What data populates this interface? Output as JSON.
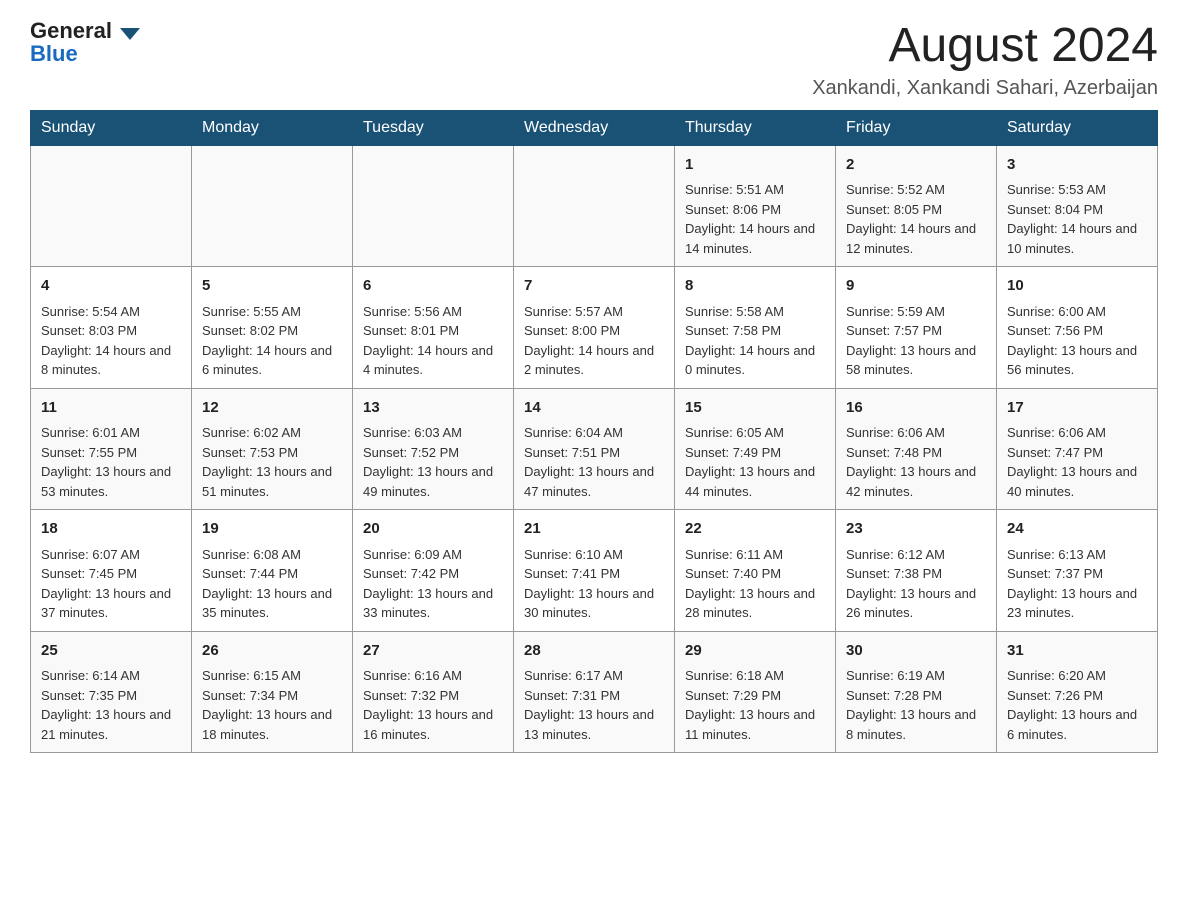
{
  "header": {
    "logo_general": "General",
    "logo_blue": "Blue",
    "month_year": "August 2024",
    "location": "Xankandi, Xankandi Sahari, Azerbaijan"
  },
  "weekdays": [
    "Sunday",
    "Monday",
    "Tuesday",
    "Wednesday",
    "Thursday",
    "Friday",
    "Saturday"
  ],
  "weeks": [
    [
      {
        "day": "",
        "sunrise": "",
        "sunset": "",
        "daylight": ""
      },
      {
        "day": "",
        "sunrise": "",
        "sunset": "",
        "daylight": ""
      },
      {
        "day": "",
        "sunrise": "",
        "sunset": "",
        "daylight": ""
      },
      {
        "day": "",
        "sunrise": "",
        "sunset": "",
        "daylight": ""
      },
      {
        "day": "1",
        "sunrise": "Sunrise: 5:51 AM",
        "sunset": "Sunset: 8:06 PM",
        "daylight": "Daylight: 14 hours and 14 minutes."
      },
      {
        "day": "2",
        "sunrise": "Sunrise: 5:52 AM",
        "sunset": "Sunset: 8:05 PM",
        "daylight": "Daylight: 14 hours and 12 minutes."
      },
      {
        "day": "3",
        "sunrise": "Sunrise: 5:53 AM",
        "sunset": "Sunset: 8:04 PM",
        "daylight": "Daylight: 14 hours and 10 minutes."
      }
    ],
    [
      {
        "day": "4",
        "sunrise": "Sunrise: 5:54 AM",
        "sunset": "Sunset: 8:03 PM",
        "daylight": "Daylight: 14 hours and 8 minutes."
      },
      {
        "day": "5",
        "sunrise": "Sunrise: 5:55 AM",
        "sunset": "Sunset: 8:02 PM",
        "daylight": "Daylight: 14 hours and 6 minutes."
      },
      {
        "day": "6",
        "sunrise": "Sunrise: 5:56 AM",
        "sunset": "Sunset: 8:01 PM",
        "daylight": "Daylight: 14 hours and 4 minutes."
      },
      {
        "day": "7",
        "sunrise": "Sunrise: 5:57 AM",
        "sunset": "Sunset: 8:00 PM",
        "daylight": "Daylight: 14 hours and 2 minutes."
      },
      {
        "day": "8",
        "sunrise": "Sunrise: 5:58 AM",
        "sunset": "Sunset: 7:58 PM",
        "daylight": "Daylight: 14 hours and 0 minutes."
      },
      {
        "day": "9",
        "sunrise": "Sunrise: 5:59 AM",
        "sunset": "Sunset: 7:57 PM",
        "daylight": "Daylight: 13 hours and 58 minutes."
      },
      {
        "day": "10",
        "sunrise": "Sunrise: 6:00 AM",
        "sunset": "Sunset: 7:56 PM",
        "daylight": "Daylight: 13 hours and 56 minutes."
      }
    ],
    [
      {
        "day": "11",
        "sunrise": "Sunrise: 6:01 AM",
        "sunset": "Sunset: 7:55 PM",
        "daylight": "Daylight: 13 hours and 53 minutes."
      },
      {
        "day": "12",
        "sunrise": "Sunrise: 6:02 AM",
        "sunset": "Sunset: 7:53 PM",
        "daylight": "Daylight: 13 hours and 51 minutes."
      },
      {
        "day": "13",
        "sunrise": "Sunrise: 6:03 AM",
        "sunset": "Sunset: 7:52 PM",
        "daylight": "Daylight: 13 hours and 49 minutes."
      },
      {
        "day": "14",
        "sunrise": "Sunrise: 6:04 AM",
        "sunset": "Sunset: 7:51 PM",
        "daylight": "Daylight: 13 hours and 47 minutes."
      },
      {
        "day": "15",
        "sunrise": "Sunrise: 6:05 AM",
        "sunset": "Sunset: 7:49 PM",
        "daylight": "Daylight: 13 hours and 44 minutes."
      },
      {
        "day": "16",
        "sunrise": "Sunrise: 6:06 AM",
        "sunset": "Sunset: 7:48 PM",
        "daylight": "Daylight: 13 hours and 42 minutes."
      },
      {
        "day": "17",
        "sunrise": "Sunrise: 6:06 AM",
        "sunset": "Sunset: 7:47 PM",
        "daylight": "Daylight: 13 hours and 40 minutes."
      }
    ],
    [
      {
        "day": "18",
        "sunrise": "Sunrise: 6:07 AM",
        "sunset": "Sunset: 7:45 PM",
        "daylight": "Daylight: 13 hours and 37 minutes."
      },
      {
        "day": "19",
        "sunrise": "Sunrise: 6:08 AM",
        "sunset": "Sunset: 7:44 PM",
        "daylight": "Daylight: 13 hours and 35 minutes."
      },
      {
        "day": "20",
        "sunrise": "Sunrise: 6:09 AM",
        "sunset": "Sunset: 7:42 PM",
        "daylight": "Daylight: 13 hours and 33 minutes."
      },
      {
        "day": "21",
        "sunrise": "Sunrise: 6:10 AM",
        "sunset": "Sunset: 7:41 PM",
        "daylight": "Daylight: 13 hours and 30 minutes."
      },
      {
        "day": "22",
        "sunrise": "Sunrise: 6:11 AM",
        "sunset": "Sunset: 7:40 PM",
        "daylight": "Daylight: 13 hours and 28 minutes."
      },
      {
        "day": "23",
        "sunrise": "Sunrise: 6:12 AM",
        "sunset": "Sunset: 7:38 PM",
        "daylight": "Daylight: 13 hours and 26 minutes."
      },
      {
        "day": "24",
        "sunrise": "Sunrise: 6:13 AM",
        "sunset": "Sunset: 7:37 PM",
        "daylight": "Daylight: 13 hours and 23 minutes."
      }
    ],
    [
      {
        "day": "25",
        "sunrise": "Sunrise: 6:14 AM",
        "sunset": "Sunset: 7:35 PM",
        "daylight": "Daylight: 13 hours and 21 minutes."
      },
      {
        "day": "26",
        "sunrise": "Sunrise: 6:15 AM",
        "sunset": "Sunset: 7:34 PM",
        "daylight": "Daylight: 13 hours and 18 minutes."
      },
      {
        "day": "27",
        "sunrise": "Sunrise: 6:16 AM",
        "sunset": "Sunset: 7:32 PM",
        "daylight": "Daylight: 13 hours and 16 minutes."
      },
      {
        "day": "28",
        "sunrise": "Sunrise: 6:17 AM",
        "sunset": "Sunset: 7:31 PM",
        "daylight": "Daylight: 13 hours and 13 minutes."
      },
      {
        "day": "29",
        "sunrise": "Sunrise: 6:18 AM",
        "sunset": "Sunset: 7:29 PM",
        "daylight": "Daylight: 13 hours and 11 minutes."
      },
      {
        "day": "30",
        "sunrise": "Sunrise: 6:19 AM",
        "sunset": "Sunset: 7:28 PM",
        "daylight": "Daylight: 13 hours and 8 minutes."
      },
      {
        "day": "31",
        "sunrise": "Sunrise: 6:20 AM",
        "sunset": "Sunset: 7:26 PM",
        "daylight": "Daylight: 13 hours and 6 minutes."
      }
    ]
  ]
}
